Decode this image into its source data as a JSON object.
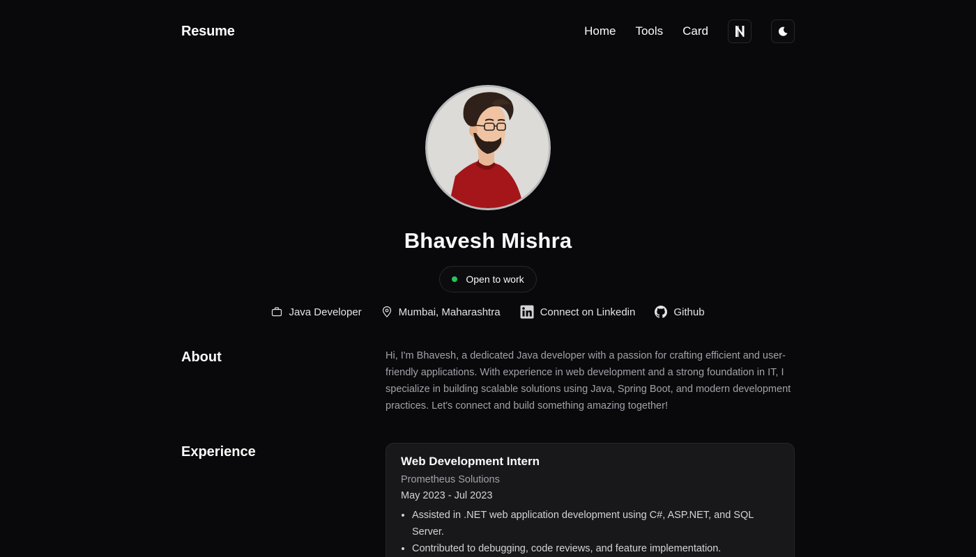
{
  "header": {
    "brand": "Resume",
    "nav": [
      "Home",
      "Tools",
      "Card"
    ]
  },
  "icons": {
    "n_logo": "n-logo-icon",
    "theme_toggle": "moon-icon"
  },
  "profile": {
    "name": "Bhavesh Mishra",
    "status": "Open to work",
    "status_color": "#22c55e",
    "meta": [
      {
        "icon": "briefcase-icon",
        "label": "Java Developer"
      },
      {
        "icon": "map-pin-icon",
        "label": "Mumbai, Maharashtra"
      },
      {
        "icon": "linkedin-icon",
        "label": "Connect on Linkedin"
      },
      {
        "icon": "github-icon",
        "label": "Github"
      }
    ]
  },
  "about": {
    "title": "About",
    "text": "Hi, I'm Bhavesh, a dedicated Java developer with a passion for crafting efficient and user-friendly applications. With experience in web development and a strong foundation in IT, I specialize in building scalable solutions using Java, Spring Boot, and modern development practices. Let's connect and build something amazing together!"
  },
  "experience": {
    "title": "Experience",
    "items": [
      {
        "role": "Web Development Intern",
        "company": "Prometheus Solutions",
        "dates": "May 2023 - Jul 2023",
        "bullets": [
          "Assisted in .NET web application development using C#, ASP.NET, and SQL Server.",
          "Contributed to debugging, code reviews, and feature implementation."
        ]
      }
    ]
  }
}
